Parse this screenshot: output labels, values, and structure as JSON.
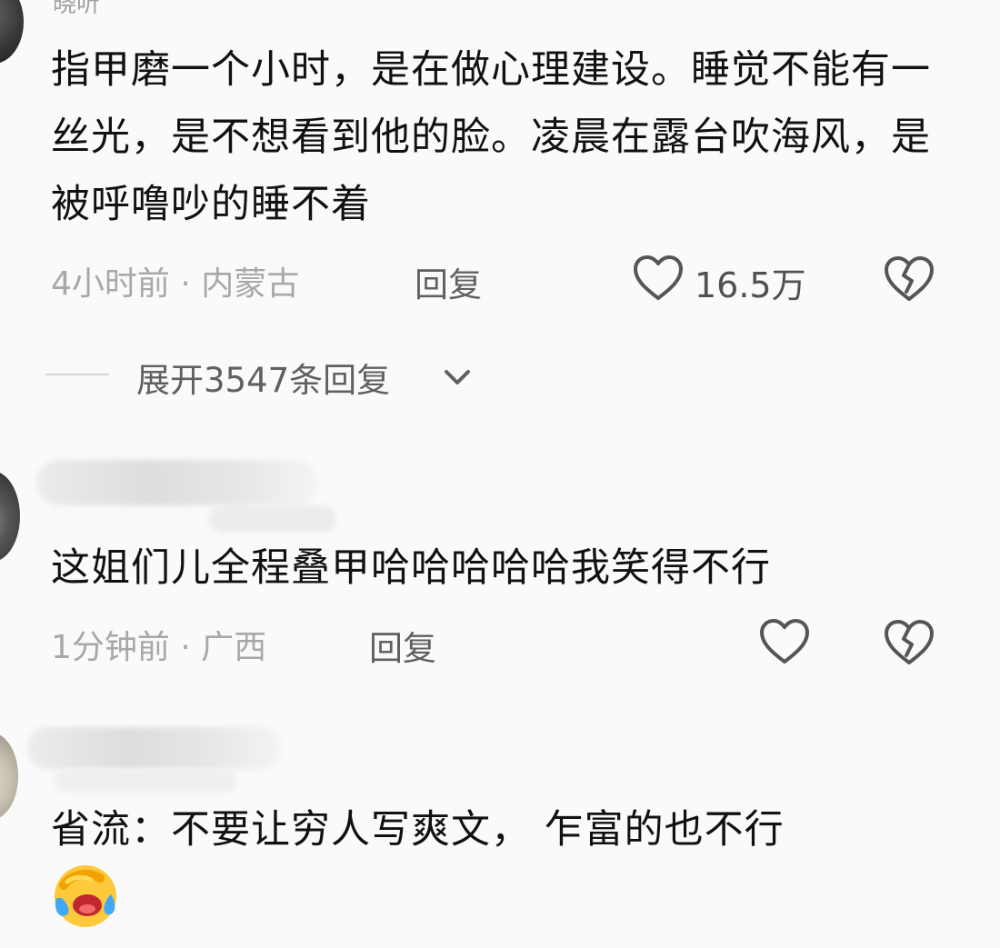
{
  "comments": [
    {
      "username": "晓听",
      "text": "指甲磨一个小时，是在做心理建设。睡觉不能有一丝光，是不想看到他的脸。凌晨在露台吹海风，是被呼噜吵的睡不着",
      "time_location": "4小时前 · 内蒙古",
      "reply_label": "回复",
      "like_count": "16.5万",
      "expand_replies": "展开3547条回复"
    },
    {
      "text": "这姐们儿全程叠甲哈哈哈哈哈我笑得不行",
      "time_location": "1分钟前 · 广西",
      "reply_label": "回复"
    },
    {
      "text": "省流：不要让穷人写爽文， 乍富的也不行",
      "emoji": "laughing-crying-emoji"
    }
  ],
  "icons": {
    "like": "heart-outline-icon",
    "dislike": "broken-heart-icon",
    "expand": "chevron-down-icon"
  },
  "colors": {
    "background": "#fafafa",
    "text": "#111111",
    "meta": "#a8a8a8",
    "action": "#606060"
  }
}
